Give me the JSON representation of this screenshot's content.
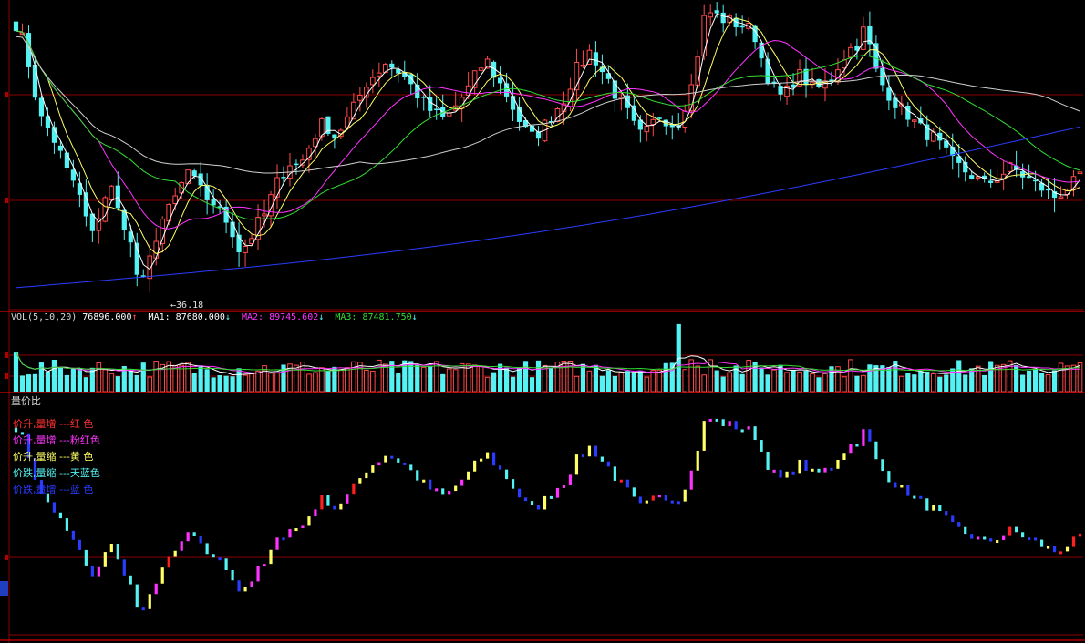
{
  "colors": {
    "background": "#000000",
    "grid": "#8b0000",
    "up": "#ff4a4a",
    "down": "#54f2f2",
    "ma_white": "#ffffff",
    "ma_yellow": "#ffff66",
    "ma_magenta": "#ff33ff",
    "ma_green": "#33dd33",
    "ma_gray": "#cfcfcf",
    "ma_blue": "#2a3cff"
  },
  "volume_header": {
    "label": "VOL(5,10,20)",
    "vol_value": "76896.000",
    "vol_arrow": "↑",
    "ma1_label": "MA1:",
    "ma1_value": "87680.000",
    "ma1_arrow": "↓",
    "ma2_label": "MA2:",
    "ma2_value": "89745.602",
    "ma2_arrow": "↓",
    "ma3_label": "MA3:",
    "ma3_value": "87481.750",
    "ma3_arrow": "↓"
  },
  "price_low_label": "36.18",
  "indicator": {
    "title": "量价比",
    "legend": [
      {
        "text": "价升,量增  ---红  色",
        "color": "#ff3030"
      },
      {
        "text": "价升,量增  ---粉红色",
        "color": "#ff33ff"
      },
      {
        "text": "价升,量缩  ---黄  色",
        "color": "#ffff66"
      },
      {
        "text": "价跌,量缩  ---天蓝色",
        "color": "#54f2f2"
      },
      {
        "text": "价跌,量增  ---蓝  色",
        "color": "#2a3cff"
      }
    ]
  },
  "chart_data": [
    {
      "type": "candlestick",
      "title": "",
      "series_count": 168,
      "close_path": [
        0.95,
        0.88,
        0.74,
        0.62,
        0.58,
        0.52,
        0.44,
        0.4,
        0.3,
        0.22,
        0.34,
        0.4,
        0.3,
        0.25,
        0.1,
        0.06,
        0.2,
        0.28,
        0.32,
        0.38,
        0.45,
        0.4,
        0.36,
        0.34,
        0.3,
        0.26,
        0.18,
        0.2,
        0.26,
        0.3,
        0.38,
        0.44,
        0.48,
        0.46,
        0.52,
        0.58,
        0.62,
        0.56,
        0.6,
        0.64,
        0.7,
        0.76,
        0.78,
        0.82,
        0.8,
        0.78,
        0.74,
        0.7,
        0.66,
        0.64,
        0.62,
        0.66,
        0.7,
        0.74,
        0.8,
        0.82,
        0.76,
        0.72,
        0.66,
        0.6,
        0.56,
        0.58,
        0.62,
        0.66,
        0.7,
        0.78,
        0.82,
        0.86,
        0.8,
        0.76,
        0.7,
        0.66,
        0.6,
        0.56,
        0.6,
        0.64,
        0.62,
        0.6,
        0.68,
        0.76,
        0.96,
        0.99,
        0.97,
        0.96,
        0.95,
        0.94,
        0.92,
        0.82,
        0.74,
        0.7,
        0.72,
        0.78,
        0.76,
        0.72,
        0.74,
        0.76,
        0.82,
        0.86,
        0.88,
        0.94,
        0.8,
        0.74,
        0.7,
        0.66,
        0.64,
        0.6,
        0.58,
        0.56,
        0.52,
        0.48,
        0.46,
        0.44,
        0.42,
        0.4,
        0.42,
        0.44,
        0.46,
        0.44,
        0.42,
        0.4,
        0.38,
        0.36,
        0.38,
        0.4,
        0.42
      ],
      "ma_lines": [
        "white",
        "yellow",
        "magenta",
        "green",
        "gray",
        "blue"
      ],
      "annotations": [
        "36.18"
      ]
    },
    {
      "type": "bar",
      "title": "VOL(5,10,20)",
      "series": [
        {
          "name": "MA1"
        },
        {
          "name": "MA2"
        },
        {
          "name": "MA3"
        }
      ],
      "values_latest": {
        "VOL": 76896.0,
        "MA1": 87680.0,
        "MA2": 89745.602,
        "MA3": 87481.75
      }
    },
    {
      "type": "bar",
      "title": "量价比",
      "categories": [
        "价升,量增",
        "价升,量增",
        "价升,量缩",
        "价跌,量缩",
        "价跌,量增"
      ]
    }
  ]
}
